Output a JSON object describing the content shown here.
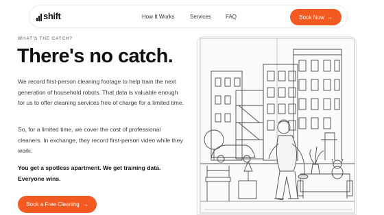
{
  "nav": {
    "logo_text": "shift",
    "links": [
      "How It Works",
      "Services",
      "FAQ"
    ],
    "cta_label": "Book Now",
    "cta_arrow": "→"
  },
  "hero": {
    "eyebrow": "WHAT'S THE CATCH?",
    "title": "There's no catch.",
    "p1": "We record first-person cleaning footage to help train the next generation of household robots. That data is valuable enough for us to offer cleaning services free of charge for a limited time.",
    "p2": "So, for a limited time, we cover the cost of professional cleaners. In exchange, they record first-person video while they work.",
    "p3": "You get a spotless apartment. We get training data. Everyone wins.",
    "cta_label": "Book a Free Cleaning",
    "cta_arrow": "→"
  },
  "colors": {
    "accent": "#f25a22",
    "text": "#111111",
    "muted": "#3a3a3a"
  }
}
